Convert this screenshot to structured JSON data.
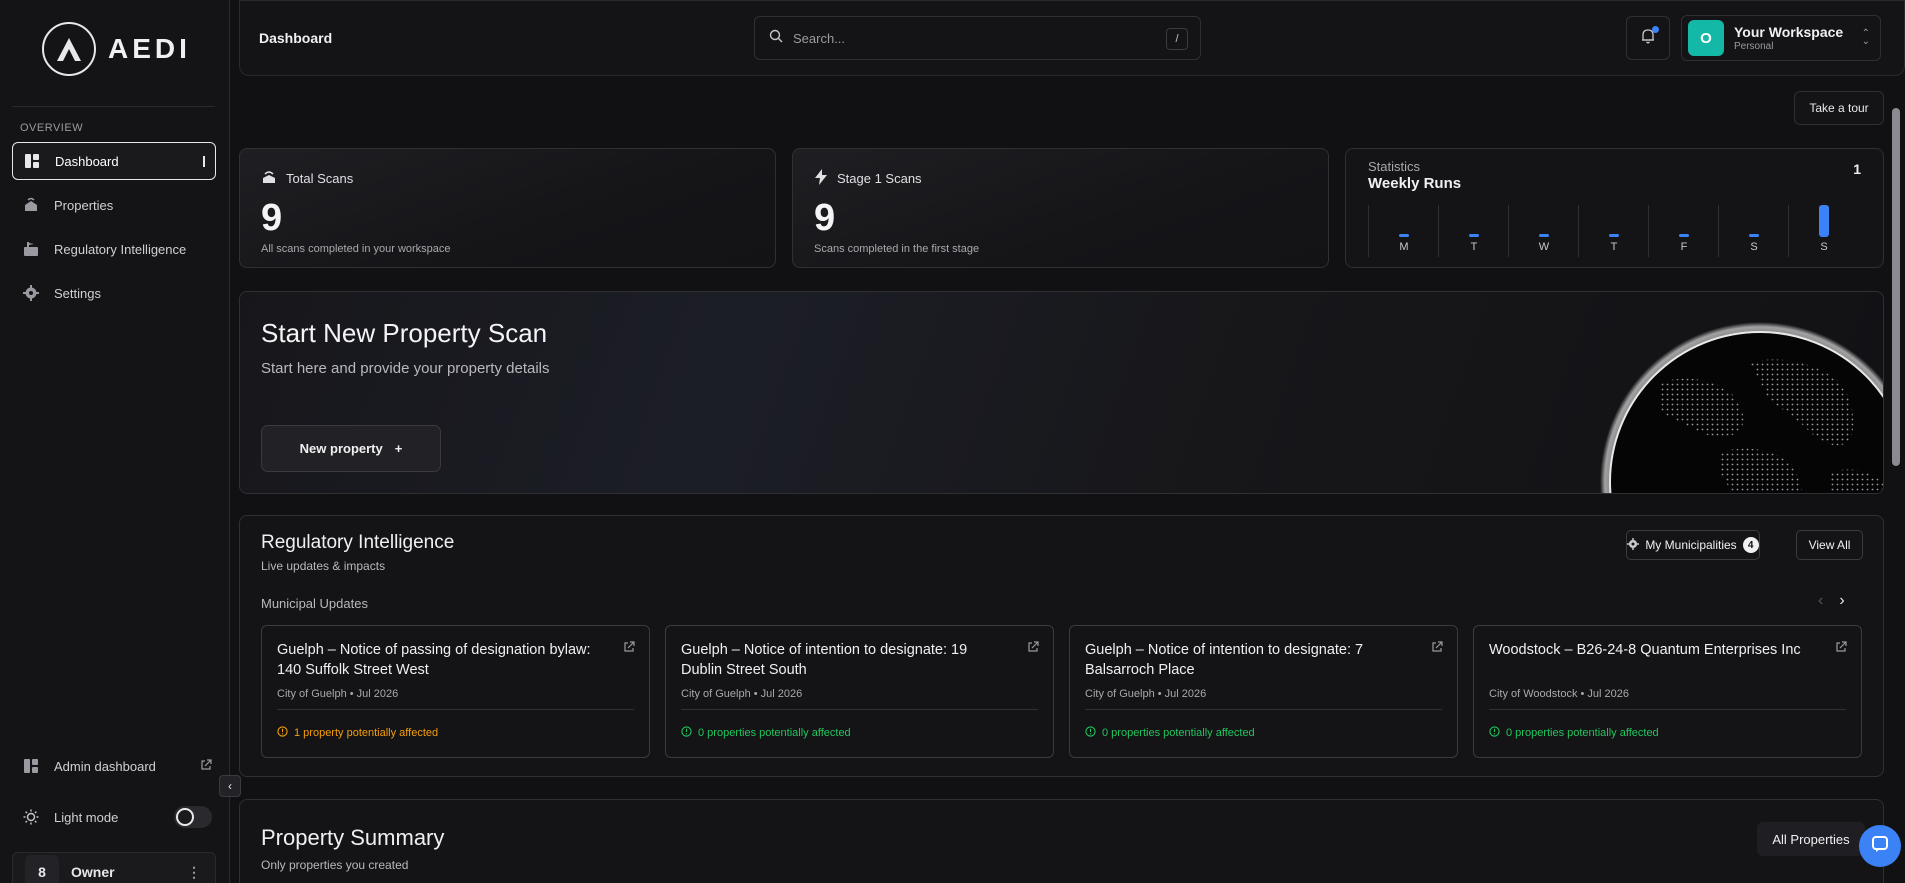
{
  "brand": {
    "name": "AEDI"
  },
  "sidebar": {
    "section_label": "OVERVIEW",
    "items": [
      {
        "label": "Dashboard",
        "icon": "dashboard-icon",
        "active": true
      },
      {
        "label": "Properties",
        "icon": "properties-icon",
        "active": false
      },
      {
        "label": "Regulatory Intelligence",
        "icon": "regulatory-icon",
        "active": false
      },
      {
        "label": "Settings",
        "icon": "gear-icon",
        "active": false
      }
    ],
    "admin_label": "Admin dashboard",
    "light_mode_label": "Light mode",
    "user": {
      "initial": "8",
      "name": "Owner"
    }
  },
  "header": {
    "title": "Dashboard",
    "search_placeholder": "Search...",
    "search_shortcut": "/",
    "workspace": {
      "initial": "O",
      "name": "Your Workspace",
      "type": "Personal",
      "color": "#14b8a6"
    }
  },
  "tour_label": "Take a tour",
  "stats": {
    "total": {
      "label": "Total Scans",
      "value": "9",
      "caption": "All scans completed in your workspace"
    },
    "stage1": {
      "label": "Stage 1 Scans",
      "value": "9",
      "caption": "Scans completed in the first stage"
    },
    "weekly": {
      "sup": "Statistics",
      "title": "Weekly Runs",
      "count": "1",
      "days": [
        "M",
        "T",
        "W",
        "T",
        "F",
        "S",
        "S"
      ],
      "values": [
        0,
        0,
        0,
        0,
        0,
        0,
        1
      ],
      "accent": "#3b82f6"
    }
  },
  "hero": {
    "title": "Start New Property Scan",
    "subtitle": "Start here and provide your property details",
    "button": "New property",
    "button_icon": "+"
  },
  "regulatory": {
    "title": "Regulatory Intelligence",
    "subtitle": "Live updates & impacts",
    "municipalities_label": "My Municipalities",
    "municipalities_count": "4",
    "view_all": "View All",
    "updates_label": "Municipal Updates",
    "updates": [
      {
        "title": "Guelph – Notice of passing of designation bylaw: 140 Suffolk Street West",
        "meta": "City of Guelph • Jul 2026",
        "impact": "1 property potentially affected",
        "status": "warn"
      },
      {
        "title": "Guelph – Notice of intention to designate: 19 Dublin Street South",
        "meta": "City of Guelph • Jul 2026",
        "impact": "0 properties potentially affected",
        "status": "ok"
      },
      {
        "title": "Guelph – Notice of intention to designate: 7 Balsarroch Place",
        "meta": "City of Guelph • Jul 2026",
        "impact": "0 properties potentially affected",
        "status": "ok"
      },
      {
        "title": "Woodstock – B26-24-8 Quantum Enterprises Inc",
        "meta": "City of Woodstock • Jul 2026",
        "impact": "0 properties potentially affected",
        "status": "ok"
      }
    ]
  },
  "property_summary": {
    "title": "Property Summary",
    "subtitle": "Only properties you created",
    "all_button": "All Properties"
  },
  "colors": {
    "accent": "#3b82f6",
    "warn": "#f59e0b",
    "ok": "#22c55e"
  }
}
